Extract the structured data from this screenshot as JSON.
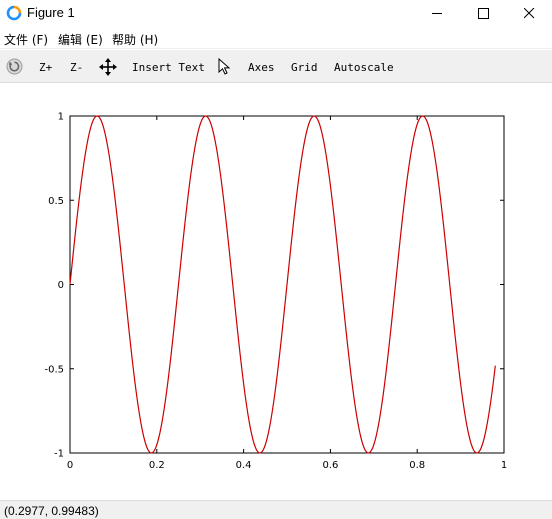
{
  "window": {
    "title": "Figure 1"
  },
  "menu": {
    "file": "文件 (F)",
    "edit": "编辑 (E)",
    "help": "帮助 (H)"
  },
  "toolbar": {
    "zoom_in": "Z+",
    "zoom_out": "Z-",
    "insert_text": "Insert Text",
    "axes": "Axes",
    "grid": "Grid",
    "autoscale": "Autoscale"
  },
  "status": {
    "coords": "(0.2977, 0.99483)"
  },
  "colors": {
    "line": "#cc0000",
    "toolbar_bg": "#f0f0f0"
  },
  "chart_data": {
    "type": "line",
    "title": "",
    "xlabel": "",
    "ylabel": "",
    "xlim": [
      0,
      1
    ],
    "ylim": [
      -1,
      1
    ],
    "x_ticks": [
      "0",
      "0.2",
      "0.4",
      "0.6",
      "0.8",
      "1"
    ],
    "y_ticks": [
      "1",
      "0.5",
      "0",
      "-0.5",
      "-1"
    ],
    "series": [
      {
        "color": "#cc0000",
        "function": "sin(8*pi*x)",
        "x_range": [
          0,
          0.98
        ],
        "step": 0.0025
      }
    ],
    "grid": false
  }
}
